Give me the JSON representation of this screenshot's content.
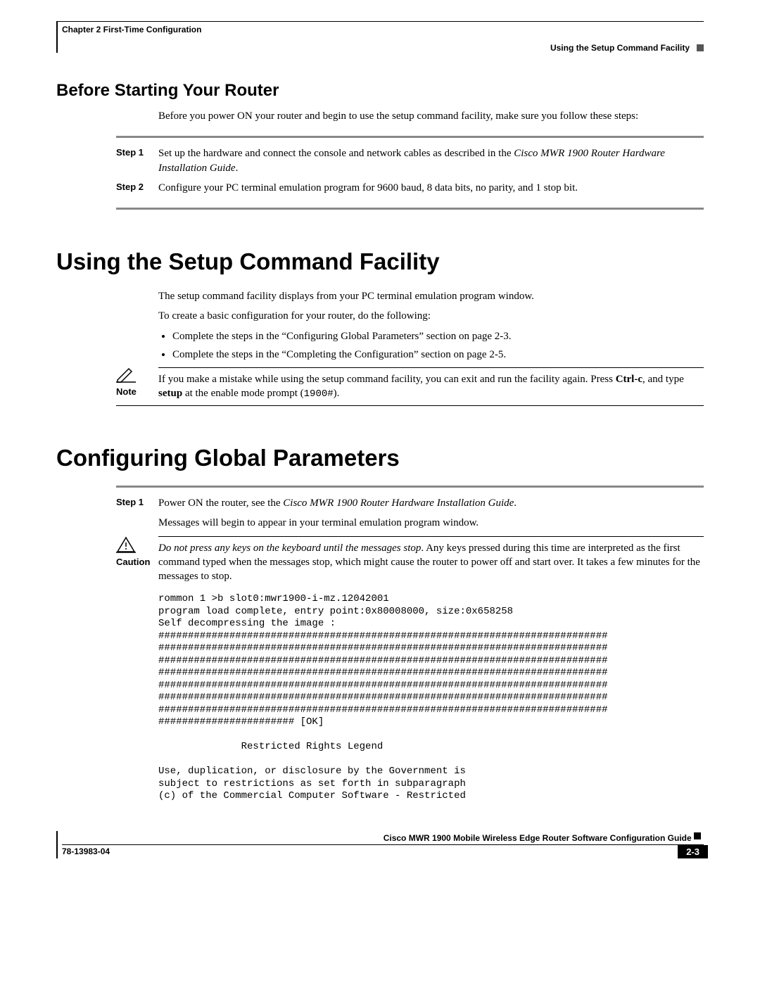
{
  "header": {
    "chapter": "Chapter 2      First-Time Configuration",
    "section": "Using the Setup Command Facility"
  },
  "s1": {
    "heading": "Before Starting Your Router",
    "intro": "Before you power ON your router and begin to use the setup command facility, make sure you follow these steps:",
    "steps": [
      {
        "label": "Step 1",
        "text_a": "Set up the hardware and connect the console and network cables as described in the ",
        "text_ital": "Cisco MWR 1900 Router Hardware Installation Guide",
        "text_b": "."
      },
      {
        "label": "Step 2",
        "text_a": "Configure your PC terminal emulation program for 9600 baud, 8 data bits, no parity, and 1 stop bit.",
        "text_ital": "",
        "text_b": ""
      }
    ]
  },
  "s2": {
    "heading": "Using the Setup Command Facility",
    "p1": "The setup command facility displays from your PC terminal emulation program window.",
    "p2": "To create a basic configuration for your router, do the following:",
    "bullets": [
      "Complete the steps in the “Configuring Global Parameters” section on page 2-3.",
      "Complete the steps in the “Completing the Configuration” section on page 2-5."
    ],
    "note": {
      "label": "Note",
      "text_a": "If you make a mistake while using the setup command facility, you can exit and run the facility again. Press ",
      "b1": "Ctrl-c",
      "text_b": ", and type ",
      "b2": "setup",
      "text_c": " at the enable mode prompt (",
      "tt": "1900#",
      "text_d": ")."
    }
  },
  "s3": {
    "heading": "Configuring Global Parameters",
    "step1": {
      "label": "Step 1",
      "text_a": "Power ON the router, see the ",
      "ital": "Cisco MWR 1900 Router Hardware Installation Guide",
      "text_b": ".",
      "p2": "Messages will begin to appear in your terminal emulation program window."
    },
    "caution": {
      "label": "Caution",
      "ital": "Do not press any keys on the keyboard until the messages stop",
      "rest": ". Any keys pressed during this time are interpreted as the first command typed when the messages stop, which might cause the router to power off and start over. It takes a few minutes for the messages to stop."
    },
    "terminal": "rommon 1 >b slot0:mwr1900-i-mz.12042001\nprogram load complete, entry point:0x80008000, size:0x658258\nSelf decompressing the image :\n############################################################################\n############################################################################\n############################################################################\n############################################################################\n############################################################################\n############################################################################\n############################################################################\n####################### [OK]\n\n              Restricted Rights Legend\n\nUse, duplication, or disclosure by the Government is\nsubject to restrictions as set forth in subparagraph\n(c) of the Commercial Computer Software - Restricted"
  },
  "footer": {
    "title": "Cisco MWR 1900 Mobile Wireless Edge Router Software Configuration Guide",
    "doc": "78-13983-04",
    "page": "2-3"
  }
}
